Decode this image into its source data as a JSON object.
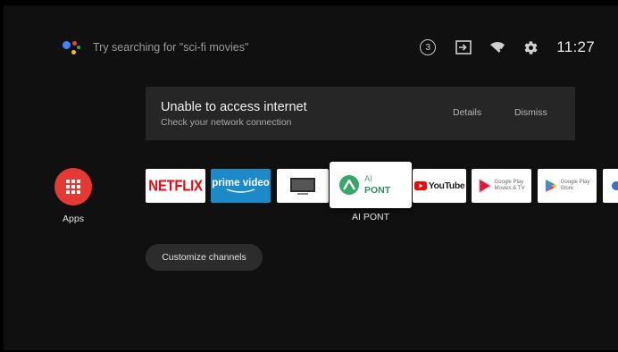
{
  "search": {
    "hint": "Try searching for \"sci-fi movies\""
  },
  "status": {
    "notification_count": "3",
    "time": "11:27"
  },
  "banner": {
    "title": "Unable to access internet",
    "subtitle": "Check your network connection",
    "details_label": "Details",
    "dismiss_label": "Dismiss"
  },
  "apps": {
    "label": "Apps",
    "color": "#e53935"
  },
  "channels": {
    "netflix": "NETFLIX",
    "prime_line1": "prime video",
    "focused_line1": "AI",
    "focused_line2": "PONT",
    "focused_label": "AI PONT",
    "youtube": "YouTube",
    "google_play_movies_line1": "Google Play",
    "google_play_movies_line2": "Movies & TV",
    "google_play_store_line1": "Google Play",
    "google_play_store_line2": "Store"
  },
  "customize": {
    "label": "Customize channels"
  },
  "colors": {
    "netflix": "#e50914",
    "prime": "#1b8ac6",
    "youtube": "#ff0000",
    "aipont": "#3aa56b"
  }
}
